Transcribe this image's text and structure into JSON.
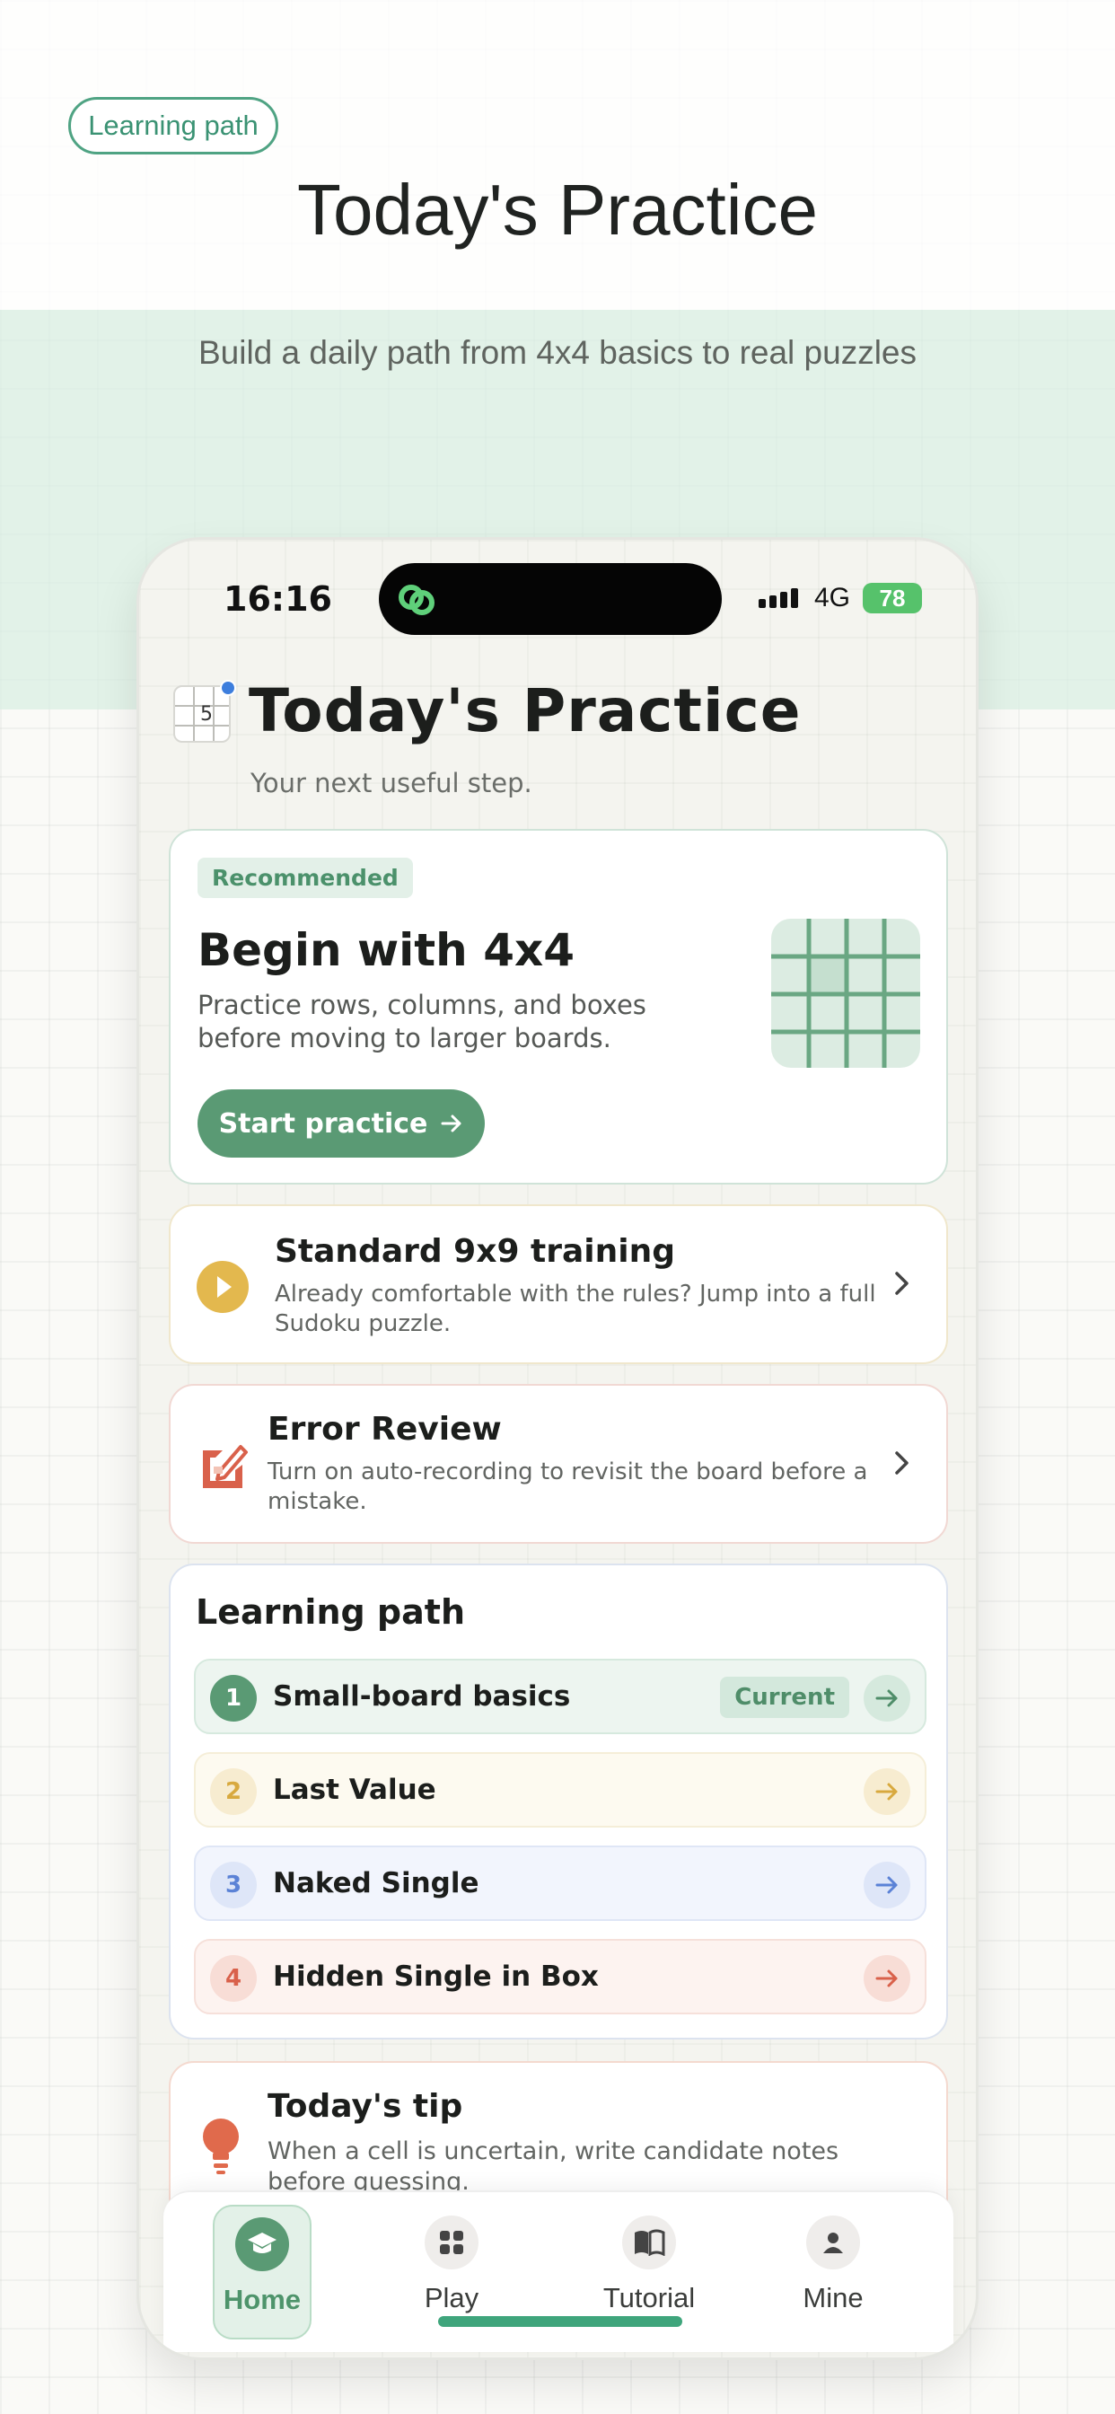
{
  "hero": {
    "pill": "Learning path",
    "title": "Today's Practice",
    "subtitle": "Build a daily path from 4x4 basics to real puzzles"
  },
  "status_bar": {
    "time": "16:16",
    "network": "4G",
    "battery": "78"
  },
  "header": {
    "title": "Today's Practice",
    "subtitle": "Your next useful step.",
    "logo_digit": "5"
  },
  "recommended": {
    "badge": "Recommended",
    "title": "Begin with 4x4",
    "description": "Practice rows, columns, and boxes before moving to larger boards.",
    "button": "Start practice"
  },
  "standard": {
    "title": "Standard 9x9 training",
    "description": "Already comfortable with the rules? Jump into a full Sudoku puzzle."
  },
  "error_review": {
    "title": "Error Review",
    "description": "Turn on auto-recording to revisit the board before a mistake."
  },
  "learning_path": {
    "title": "Learning path",
    "current_label": "Current",
    "items": [
      {
        "num": "1",
        "label": "Small-board basics"
      },
      {
        "num": "2",
        "label": "Last Value"
      },
      {
        "num": "3",
        "label": "Naked Single"
      },
      {
        "num": "4",
        "label": "Hidden Single in Box"
      }
    ]
  },
  "tip": {
    "title": "Today's tip",
    "description": "When a cell is uncertain, write candidate notes before guessing."
  },
  "tabs": {
    "home": "Home",
    "play": "Play",
    "tutorial": "Tutorial",
    "mine": "Mine"
  },
  "colors": {
    "accent_green": "#5a9a74",
    "yellow": "#e3b84e",
    "blue": "#5b82d6",
    "red": "#d9614b"
  }
}
